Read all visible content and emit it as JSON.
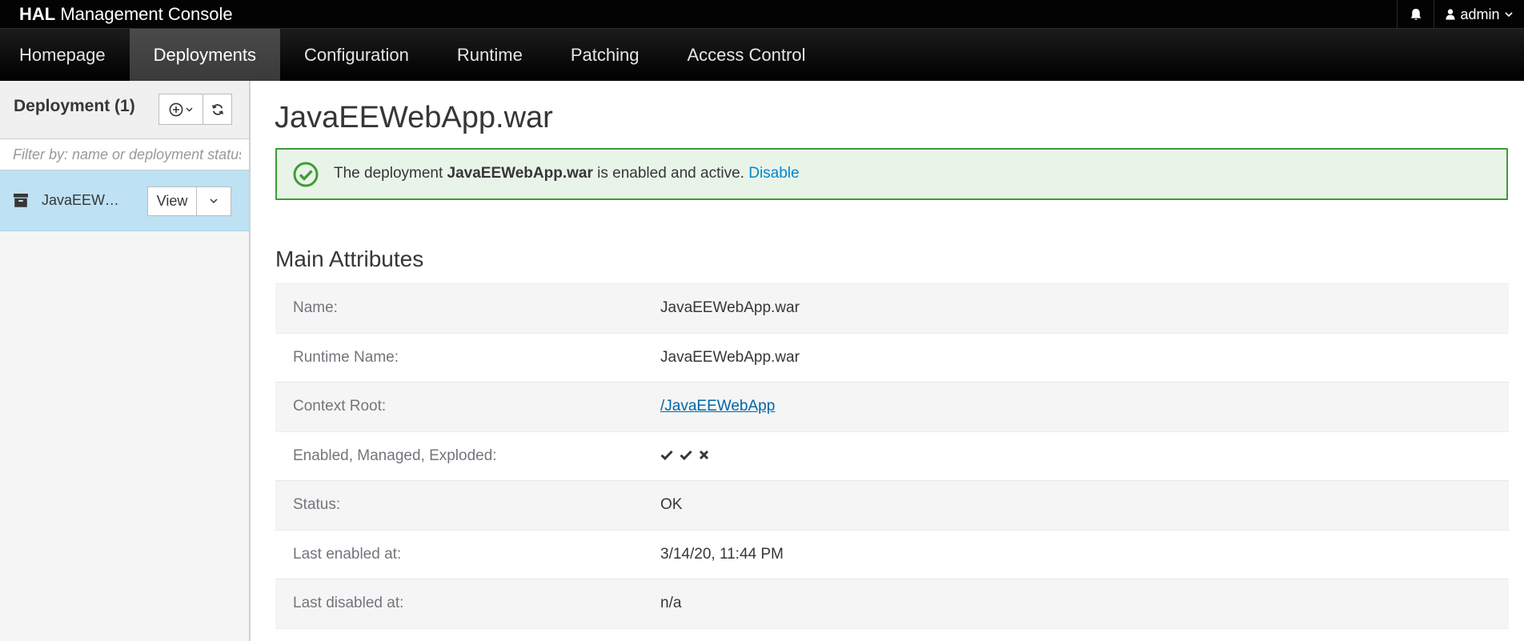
{
  "brand": {
    "bold": "HAL",
    "rest": "Management Console"
  },
  "user": {
    "name": "admin"
  },
  "nav": {
    "tabs": [
      {
        "label": "Homepage",
        "active": false
      },
      {
        "label": "Deployments",
        "active": true
      },
      {
        "label": "Configuration",
        "active": false
      },
      {
        "label": "Runtime",
        "active": false
      },
      {
        "label": "Patching",
        "active": false
      },
      {
        "label": "Access Control",
        "active": false
      }
    ]
  },
  "sidebar": {
    "title": "Deployment (1)",
    "filter_placeholder": "Filter by: name or deployment status",
    "items": [
      {
        "label": "JavaEEWe...",
        "view_label": "View"
      }
    ]
  },
  "main": {
    "title": "JavaEEWebApp.war",
    "alert": {
      "prefix": "The deployment",
      "name": "JavaEEWebApp.war",
      "suffix": "is enabled and active.",
      "link": "Disable"
    },
    "section_title": "Main Attributes",
    "attributes": [
      {
        "label": "Name:",
        "value": "JavaEEWebApp.war"
      },
      {
        "label": "Runtime Name:",
        "value": "JavaEEWebApp.war"
      },
      {
        "label": "Context Root:",
        "value": "/JavaEEWebApp"
      },
      {
        "label": "Enabled, Managed, Exploded:",
        "flags": {
          "enabled": true,
          "managed": true,
          "exploded": false
        }
      },
      {
        "label": "Status:",
        "value": "OK"
      },
      {
        "label": "Last enabled at:",
        "value": "3/14/20, 11:44 PM"
      },
      {
        "label": "Last disabled at:",
        "value": "n/a"
      }
    ]
  },
  "icons": {
    "bell": "bell-icon",
    "user": "user-icon",
    "add": "add-circle-icon",
    "refresh": "refresh-icon",
    "archive": "archive-icon",
    "ok": "ok-circle-icon"
  },
  "colors": {
    "topbar": "#030303",
    "nav_active": "#3f3f3f",
    "selected_item": "#bee1f4",
    "success_border": "#3f9c35",
    "success_bg": "#e9f4e9",
    "link": "#0088ce"
  }
}
